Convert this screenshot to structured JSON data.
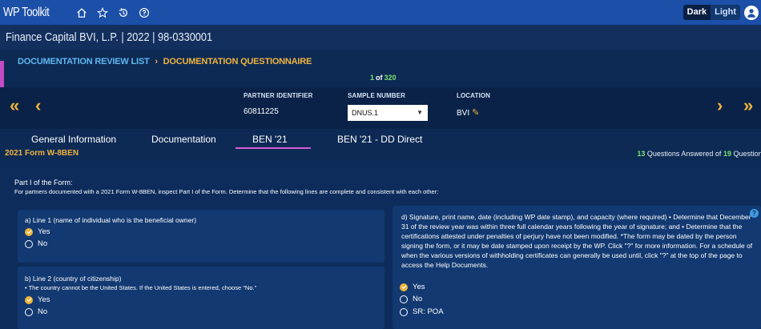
{
  "app": {
    "name": "WP Toolkit",
    "icons": [
      "home-icon",
      "star-icon",
      "history-icon",
      "help-icon"
    ],
    "theme": {
      "dark_label": "Dark",
      "light_label": "Light"
    }
  },
  "entity": {
    "name": "Finance Capital BVI, L.P.",
    "year": "2022",
    "id": "98-0330001"
  },
  "breadcrumb": {
    "parent": "DOCUMENTATION REVIEW LIST",
    "separator": "›",
    "current": "DOCUMENTATION QUESTIONNAIRE"
  },
  "pager": {
    "current": "1",
    "of": "of",
    "total": "320"
  },
  "navigator": {
    "first_label": "«",
    "prev_label": "‹",
    "next_label": "›",
    "last_label": "»",
    "partner_identifier": {
      "label": "PARTNER IDENTIFIER",
      "value": "60811225"
    },
    "sample_number": {
      "label": "SAMPLE NUMBER",
      "value": "DNUS.1"
    },
    "location": {
      "label": "LOCATION",
      "value": "BVI"
    }
  },
  "tabs": [
    {
      "label": "General Information"
    },
    {
      "label": "Documentation"
    },
    {
      "label": "BEN '21",
      "active": true
    },
    {
      "label": "BEN '21 - DD Direct"
    }
  ],
  "form": {
    "name": "2021 Form W-8BEN",
    "answered": "13",
    "total": "19",
    "answered_text_mid": "Questions Answered of",
    "answered_text_end": "Questions"
  },
  "part": {
    "title": "Part I of the Form:",
    "description": "For partners documented with a 2021 Form W-8BEN, inspect Part I of the Form. Determine that the following lines are complete and consistent with each other:"
  },
  "questions": {
    "a": {
      "text": "a) Line 1 (name of individual who is the beneficial owner)",
      "options": [
        "Yes",
        "No"
      ],
      "selected": "Yes"
    },
    "b": {
      "text": "b) Line 2 (country of citizenship)",
      "note": "• The country cannot be the United States. If the United States is entered, choose \"No.\"",
      "options": [
        "Yes",
        "No"
      ],
      "selected": "Yes"
    },
    "d": {
      "text": "d) Signature, print name, date (including WP date stamp), and capacity (where required) • Determine that December 31 of the review year was within three full calendar years following the year of signature; and • Determine that the certifications attested under penalties of perjury have not been modified. *The form may be dated by the person signing the form, or it may be date stamped upon receipt by the WP. Click \"?\" for more information. For a schedule of when the various versions of withholding certificates can generally be used until, click \"?\" at the top of the page to access the Help Documents.",
      "options": [
        "Yes",
        "No",
        "SR: POA"
      ],
      "selected": "Yes",
      "help": "?"
    }
  },
  "colors": {
    "topbar": "#1b4fa8",
    "accent_orange": "#f0b43c",
    "accent_green": "#7ee06a",
    "accent_magenta": "#d35cd6",
    "link_blue": "#5fb9f0"
  }
}
